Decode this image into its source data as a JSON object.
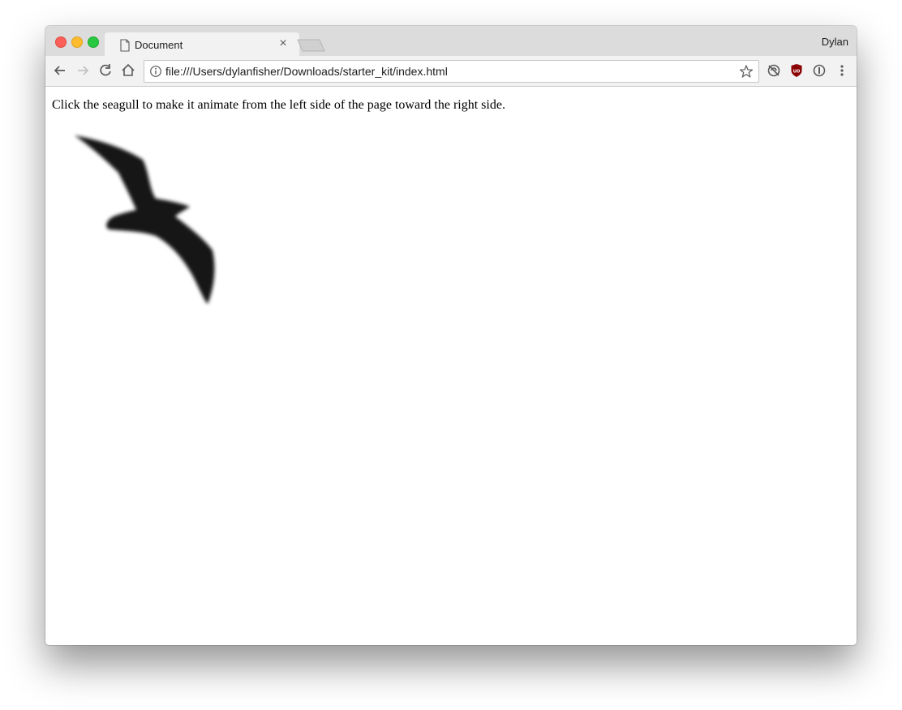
{
  "browser": {
    "tab": {
      "title": "Document"
    },
    "profile_name": "Dylan",
    "address_bar": {
      "url": "file:///Users/dylanfisher/Downloads/starter_kit/index.html"
    },
    "extension_colors": {
      "ublock": "#8b0000"
    }
  },
  "page": {
    "instruction_text": "Click the seagull to make it animate from the left side of the page toward the right side."
  }
}
